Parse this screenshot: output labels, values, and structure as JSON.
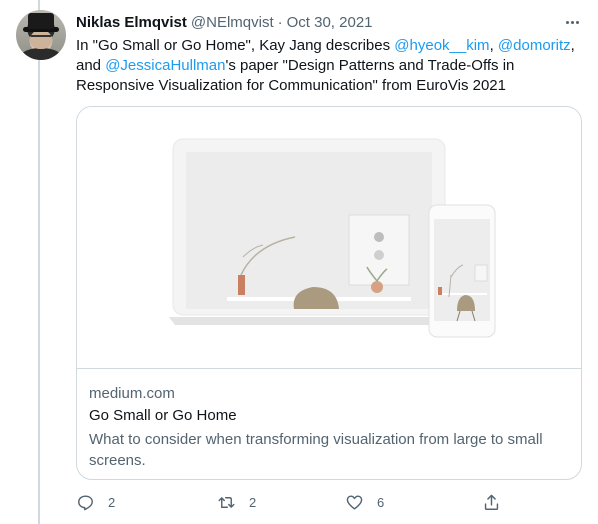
{
  "tweet": {
    "author_name": "Niklas Elmqvist",
    "author_handle": "@NElmqvist",
    "separator": "·",
    "date": "Oct 30, 2021",
    "text_parts": [
      {
        "type": "text",
        "value": "In \"Go Small or Go Home\", Kay Jang describes "
      },
      {
        "type": "mention",
        "value": "@hyeok__kim"
      },
      {
        "type": "text",
        "value": ", "
      },
      {
        "type": "mention",
        "value": "@domoritz"
      },
      {
        "type": "text",
        "value": ", and "
      },
      {
        "type": "mention",
        "value": "@JessicaHullman"
      },
      {
        "type": "text",
        "value": "'s paper \"Design Patterns and Trade-Offs in Responsive Visualization for Communication\" from EuroVis 2021"
      }
    ]
  },
  "card": {
    "domain": "medium.com",
    "title": "Go Small or Go Home",
    "description": "What to consider when transforming visualization from large to small screens."
  },
  "actions": {
    "reply_count": "2",
    "retweet_count": "2",
    "like_count": "6"
  },
  "icons": [
    "more-icon",
    "reply-icon",
    "retweet-icon",
    "like-icon",
    "share-icon"
  ],
  "colors": {
    "accent": "#1d9bf0",
    "secondary_text": "#536471",
    "border": "#cfd9de"
  }
}
